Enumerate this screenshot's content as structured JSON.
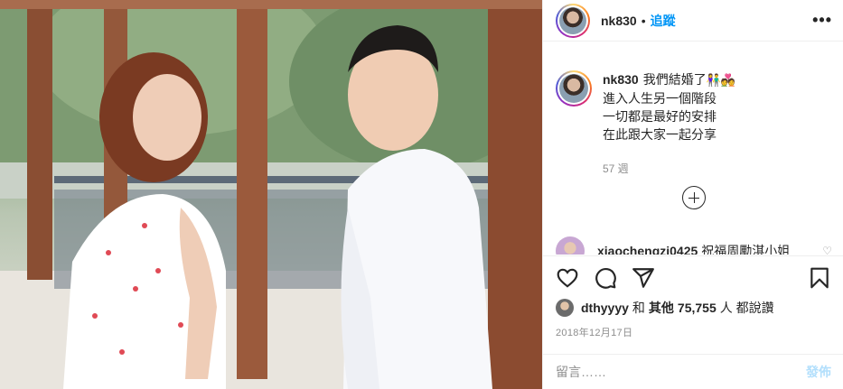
{
  "post": {
    "username": "nk830",
    "separator": "•",
    "follow_label": "追蹤",
    "more_label": "•••"
  },
  "caption": {
    "username": "nk830",
    "lines": [
      "我們結婚了",
      "進入人生另一個階段",
      "一切都是最好的安排",
      "在此跟大家一起分享"
    ],
    "emojis": "👫💑",
    "time": "57 週"
  },
  "comment": {
    "username": "xiaochengzi0425",
    "text": "祝福周勵淇小姐"
  },
  "likes": {
    "first_user": "dthyyyy",
    "joiner": "和",
    "others_label": "其他",
    "count": "75,755",
    "suffix": "人 都說讚"
  },
  "date": "2018年12月17日",
  "add_comment": {
    "placeholder": "留言……",
    "post_label": "發佈"
  },
  "colors": {
    "accent": "#0095f6",
    "post_disabled": "#b2dffc",
    "muted": "#8e8e8e",
    "text": "#262626"
  },
  "icons": [
    "heart-icon",
    "comment-icon",
    "share-icon",
    "bookmark-icon",
    "plus-circle-icon",
    "more-icon"
  ]
}
